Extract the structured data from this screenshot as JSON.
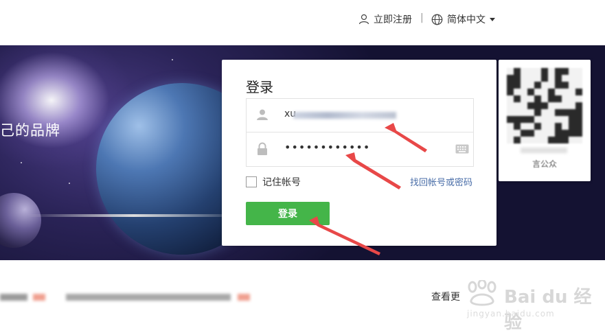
{
  "header": {
    "register_label": "立即注册",
    "separator": "|",
    "language_label": "简体中文"
  },
  "banner": {
    "tagline": "己的品牌"
  },
  "login": {
    "title": "登录",
    "username_value": "xu",
    "password_masked": "••••••••••••",
    "remember_label": "记住帐号",
    "forgot_label": "找回帐号或密码",
    "submit_label": "登录"
  },
  "qr": {
    "caption": "言公众"
  },
  "notice": {
    "view_more": "查看更"
  },
  "watermark": {
    "brand": "Bai du 经验",
    "url": "jingyan.baidu.com"
  },
  "colors": {
    "primary_button": "#44b549",
    "link": "#4a6ea8",
    "arrow": "#e84848"
  }
}
